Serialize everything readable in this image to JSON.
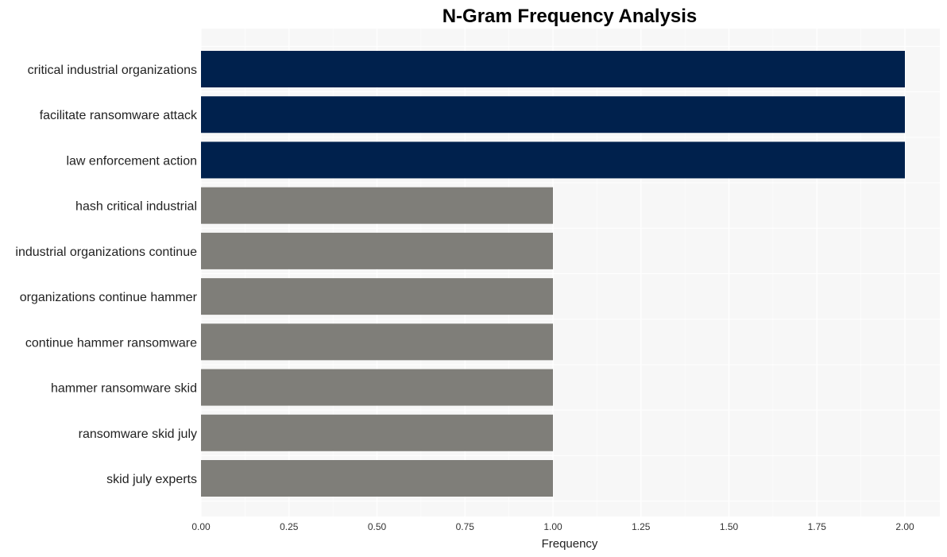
{
  "chart_data": {
    "type": "bar",
    "orientation": "horizontal",
    "title": "N-Gram Frequency Analysis",
    "xlabel": "Frequency",
    "ylabel": "",
    "xlim": [
      0,
      2.1
    ],
    "xticks": [
      0,
      0.25,
      0.5,
      0.75,
      1.0,
      1.25,
      1.5,
      1.75,
      2.0
    ],
    "xtick_labels": [
      "0.00",
      "0.25",
      "0.50",
      "0.75",
      "1.00",
      "1.25",
      "1.50",
      "1.75",
      "2.00"
    ],
    "grid": true,
    "categories": [
      "critical industrial organizations",
      "facilitate ransomware attack",
      "law enforcement action",
      "hash critical industrial",
      "industrial organizations continue",
      "organizations continue hammer",
      "continue hammer ransomware",
      "hammer ransomware skid",
      "ransomware skid july",
      "skid july experts"
    ],
    "values": [
      2,
      2,
      2,
      1,
      1,
      1,
      1,
      1,
      1,
      1
    ],
    "colors": {
      "top": "#00214d",
      "rest": "#7f7e79",
      "plot_background": "#f7f7f7",
      "grid": "#ffffff"
    }
  }
}
